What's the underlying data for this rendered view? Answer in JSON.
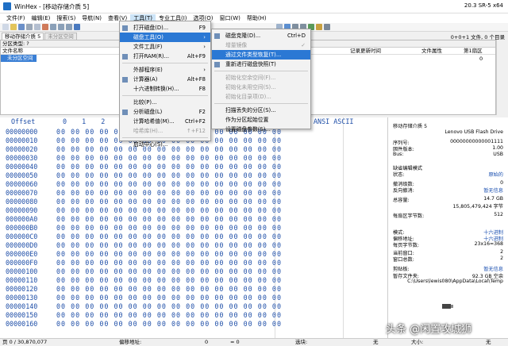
{
  "window": {
    "title": "WinHex - [移动存储介质 5]",
    "version": "20.3 SR-5 x64"
  },
  "menubar": [
    "文件(F)",
    "编辑(E)",
    "搜索(S)",
    "导航(N)",
    "查看(V)",
    "工具(T)",
    "专业工具(I)",
    "选项(O)",
    "窗口(W)",
    "帮助(H)"
  ],
  "tabs": {
    "active": "移动存储介质 5",
    "inactive": "未分区空间",
    "right": "0+0+1 文件, 0 个目录"
  },
  "partition_panel": {
    "header": "分区类型: ?",
    "cols": [
      "文件名称",
      "记录更新时间",
      "文件属性",
      "第1扇区"
    ],
    "row": "未分区空间",
    "row_sector": "0"
  },
  "hex": {
    "header_offset": "Offset",
    "header_cols": "0  1  2  3  4",
    "header_ascii": "ANSI ASCII",
    "offsets": [
      "00000000",
      "00000010",
      "00000020",
      "00000030",
      "00000040",
      "00000050",
      "00000060",
      "00000070",
      "00000080",
      "00000090",
      "000000A0",
      "000000B0",
      "000000C0",
      "000000D0",
      "000000E0",
      "000000F0",
      "00000100",
      "00000110",
      "00000120",
      "00000130",
      "00000140",
      "00000150",
      "00000160"
    ],
    "row_bytes": "00 00 00 00 00 00 00 00 00 00 00 00 00 00 00 00"
  },
  "info_panel": {
    "device": "移动存储介质 5",
    "device_name": "Lenovo USB Flash Drive",
    "rows": [
      {
        "k": "序列号:",
        "v": "00000000000001111"
      },
      {
        "k": "固件版本:",
        "v": "1.00"
      },
      {
        "k": "Bus:",
        "v": "USB"
      },
      {
        "k": "缺省编辑模式",
        "v": ""
      },
      {
        "k": "状态:",
        "v": "原始的",
        "blue": true
      },
      {
        "k": "撤消级数:",
        "v": "0"
      },
      {
        "k": "反向撤消:",
        "v": "暂无信息",
        "blue": true
      },
      {
        "k": "总容量:",
        "v": "14.7 GB"
      },
      {
        "k": "",
        "v": "15,805,479,424 字节"
      },
      {
        "k": "每扇区字节数:",
        "v": "512"
      },
      {
        "k": "模式:",
        "v": "十六进制",
        "blue": true
      },
      {
        "k": "偏移地址:",
        "v": "十六进制",
        "blue": true
      },
      {
        "k": "每页字节数:",
        "v": "23x16=368"
      },
      {
        "k": "当前窗口:",
        "v": "2"
      },
      {
        "k": "窗口总数:",
        "v": "2"
      },
      {
        "k": "剪贴板:",
        "v": "暂无信息",
        "blue": true
      },
      {
        "k": "暂存文件夹:",
        "v": "92.3 GB 空余"
      },
      {
        "k": "",
        "v": "C:\\Users\\lewis080\\AppData\\Local\\Temp"
      }
    ]
  },
  "tools_menu": [
    {
      "label": "打开磁盘(D)...",
      "sc": "F9",
      "icon": "disk-icon"
    },
    {
      "label": "磁盘工具(O)",
      "sc": "",
      "sel": true,
      "arrow": true
    },
    {
      "label": "文件工具(F)",
      "sc": "",
      "arrow": true
    },
    {
      "label": "打开RAM(R)...",
      "sc": "Alt+F9",
      "icon": "ram-icon"
    },
    {
      "div": true
    },
    {
      "label": "外部程序(E)",
      "sc": "",
      "arrow": true
    },
    {
      "label": "计算器(A)",
      "sc": "Alt+F8",
      "icon": "calculator-icon"
    },
    {
      "label": "十六进制转换(H)...",
      "sc": "F8"
    },
    {
      "div": true
    },
    {
      "label": "比较(P)...",
      "sc": ""
    },
    {
      "label": "分析磁盘(L)",
      "sc": "F2",
      "icon": "analyze-icon"
    },
    {
      "label": "计算哈希值(M)...",
      "sc": "Ctrl+F2"
    },
    {
      "label": "哈希库(H)...",
      "sc": "↑+F12",
      "dis": true
    },
    {
      "div": true
    },
    {
      "label": "启动中心(S)...",
      "sc": ""
    }
  ],
  "disk_menu": [
    {
      "label": "磁盘克隆(D)...",
      "sc": "Ctrl+D",
      "icon": "clone-icon"
    },
    {
      "label": "增量镜像",
      "sc": "✓",
      "dis": true
    },
    {
      "label": "通过文件类型恢复(T)...",
      "sc": "",
      "sel": true
    },
    {
      "label": "重新进行磁盘快照(T)",
      "sc": "",
      "icon": "snapshot-icon"
    },
    {
      "div": true
    },
    {
      "label": "初始化空余空间(F)...",
      "sc": "",
      "dis": true
    },
    {
      "label": "初始化未用空间(S)...",
      "sc": "",
      "dis": true
    },
    {
      "label": "初始化目录项(D)...",
      "sc": "",
      "dis": true
    },
    {
      "div": true
    },
    {
      "label": "扫描丢失的分区(S)...",
      "sc": ""
    },
    {
      "label": "作为分区起始位置",
      "sc": ""
    },
    {
      "label": "设置磁盘参数(S)...",
      "sc": ""
    }
  ],
  "statusbar": {
    "page": "页 0 / 30,870,077",
    "offset_label": "偏移地址:",
    "offset_val": "0",
    "equals": "= 0",
    "block": "选块:",
    "none": "无",
    "size": "大小:",
    "none2": "无"
  },
  "watermark": "头条 @闲置攻城狮",
  "colors": {
    "selection": "#2b78d4",
    "hex_blue": "#1f4fa8"
  }
}
